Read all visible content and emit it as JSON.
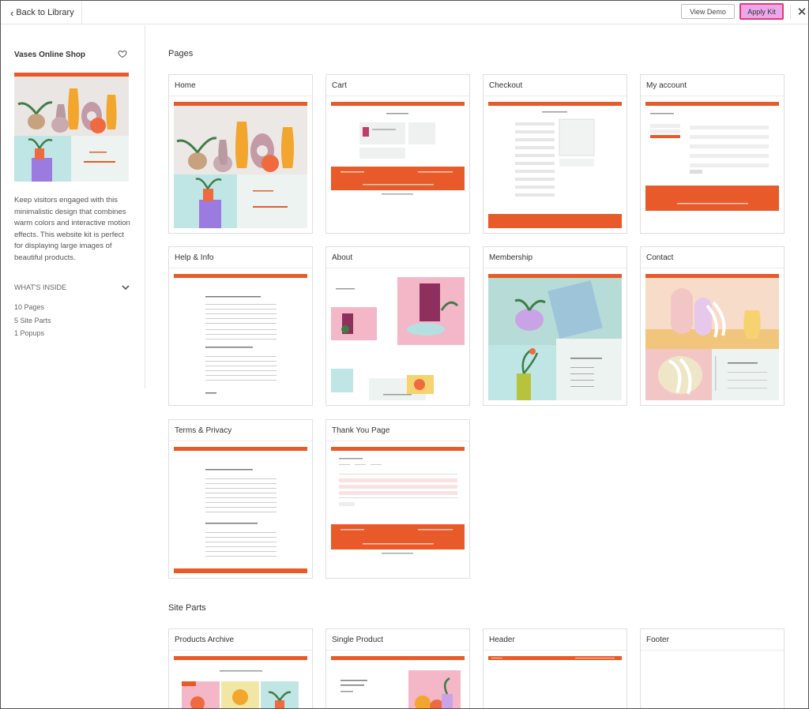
{
  "topbar": {
    "back_label": "Back to Library",
    "view_demo_label": "View Demo",
    "apply_kit_label": "Apply Kit"
  },
  "sidebar": {
    "kit_title": "Vases Online Shop",
    "description": "Keep visitors engaged with this minimalistic design that combines warm colors and interactive motion effects. This website kit is perfect for displaying large images of beautiful products.",
    "whats_inside_label": "WHAT'S INSIDE",
    "inside_items": [
      "10 Pages",
      "5 Site Parts",
      "1 Popups"
    ]
  },
  "sections": {
    "pages_title": "Pages",
    "site_parts_title": "Site Parts"
  },
  "pages": [
    {
      "title": "Home"
    },
    {
      "title": "Cart"
    },
    {
      "title": "Checkout"
    },
    {
      "title": "My account"
    },
    {
      "title": "Help & Info"
    },
    {
      "title": "About"
    },
    {
      "title": "Membership"
    },
    {
      "title": "Contact"
    },
    {
      "title": "Terms & Privacy"
    },
    {
      "title": "Thank You Page"
    }
  ],
  "site_parts": [
    {
      "title": "Products Archive"
    },
    {
      "title": "Single Product"
    },
    {
      "title": "Header"
    },
    {
      "title": "Footer"
    }
  ],
  "icons": {
    "back": "chevron-left-icon",
    "favorite": "heart-icon",
    "expand": "chevron-down-icon",
    "close": "close-icon"
  },
  "colors": {
    "brand_orange": "#e85a2a",
    "apply_kit_bg": "#eba7ea",
    "apply_kit_border": "#e8376f"
  }
}
